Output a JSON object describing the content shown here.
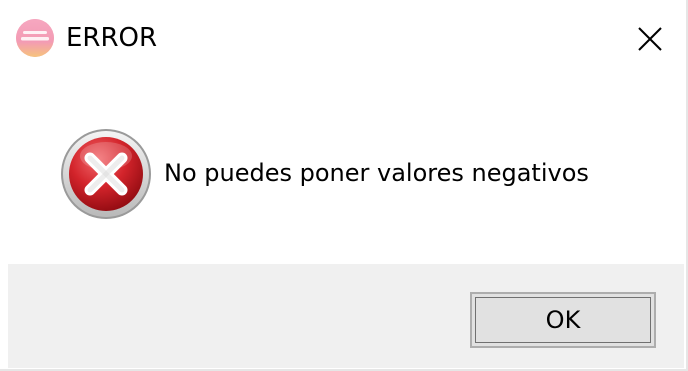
{
  "window": {
    "title": "ERROR",
    "app_icon": "app-logo-icon",
    "close_icon": "close-icon"
  },
  "dialog": {
    "icon": "error-icon",
    "message": "No puedes poner valores negativos"
  },
  "buttons": {
    "ok_label": "OK"
  },
  "colors": {
    "error_red": "#c8141e",
    "footer_bg": "#f0f0f0",
    "button_bg": "#e1e1e1"
  }
}
